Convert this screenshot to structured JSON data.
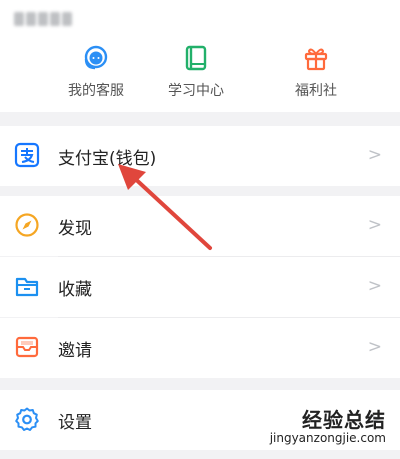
{
  "header": {
    "user_name_blurred": true
  },
  "quick_actions": [
    {
      "label": "我的客服",
      "icon": "customer-service-icon",
      "color": "#2b8ff5"
    },
    {
      "label": "学习中心",
      "icon": "study-book-icon",
      "color": "#22b06a"
    },
    {
      "label": "福利社",
      "icon": "gift-icon",
      "color": "#ff6a3c"
    }
  ],
  "menu": {
    "alipay": {
      "label": "支付宝(钱包)",
      "icon": "alipay-icon",
      "color": "#1677ff"
    },
    "discover": {
      "label": "发现",
      "icon": "compass-icon",
      "color": "#f5a623"
    },
    "favorites": {
      "label": "收藏",
      "icon": "folder-icon",
      "color": "#1c90f0"
    },
    "invite": {
      "label": "邀请",
      "icon": "invite-envelope-icon",
      "color": "#ff6a3c"
    },
    "settings": {
      "label": "设置",
      "icon": "gear-icon",
      "color": "#2b8ff5"
    },
    "chevron": ">"
  },
  "annotation": {
    "arrow_color": "#e0463c"
  },
  "watermark": {
    "title": "经验总结",
    "url": "jingyanzongjie.com"
  }
}
